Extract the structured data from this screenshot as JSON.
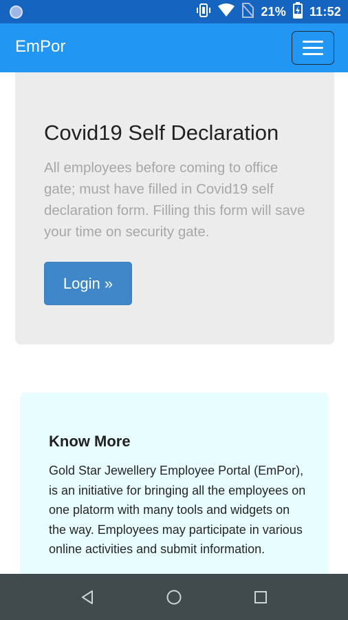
{
  "status_bar": {
    "battery": "21%",
    "time": "11:52",
    "icons": [
      "notification-dot-icon",
      "vibrate-icon",
      "wifi-icon",
      "no-sim-icon",
      "battery-charging-icon"
    ]
  },
  "navbar": {
    "brand": "EmPor",
    "toggler_icon": "hamburger-menu-icon"
  },
  "jumbotron": {
    "title": "Covid19 Self Declaration",
    "text": "All employees before coming to office gate; must have filled in Covid19 self declaration form. Filling this form will save your time on security gate.",
    "button_label": "Login »"
  },
  "know_more": {
    "title": "Know More",
    "text": "Gold Star Jewellery Employee Portal (EmPor), is an initiative for bringing all the employees on one platorm with many tools and widgets on the way. Employees may participate in various online activities and submit information."
  },
  "system_nav": {
    "icons": [
      "back-icon",
      "home-icon",
      "recents-icon"
    ]
  },
  "colors": {
    "status_bar": "#1565c0",
    "navbar": "#2196f3",
    "jumbotron_bg": "#ececec",
    "login_button": "#3f87c9",
    "know_more_bg": "#e8fdff",
    "system_nav_bg": "#414a4c"
  }
}
